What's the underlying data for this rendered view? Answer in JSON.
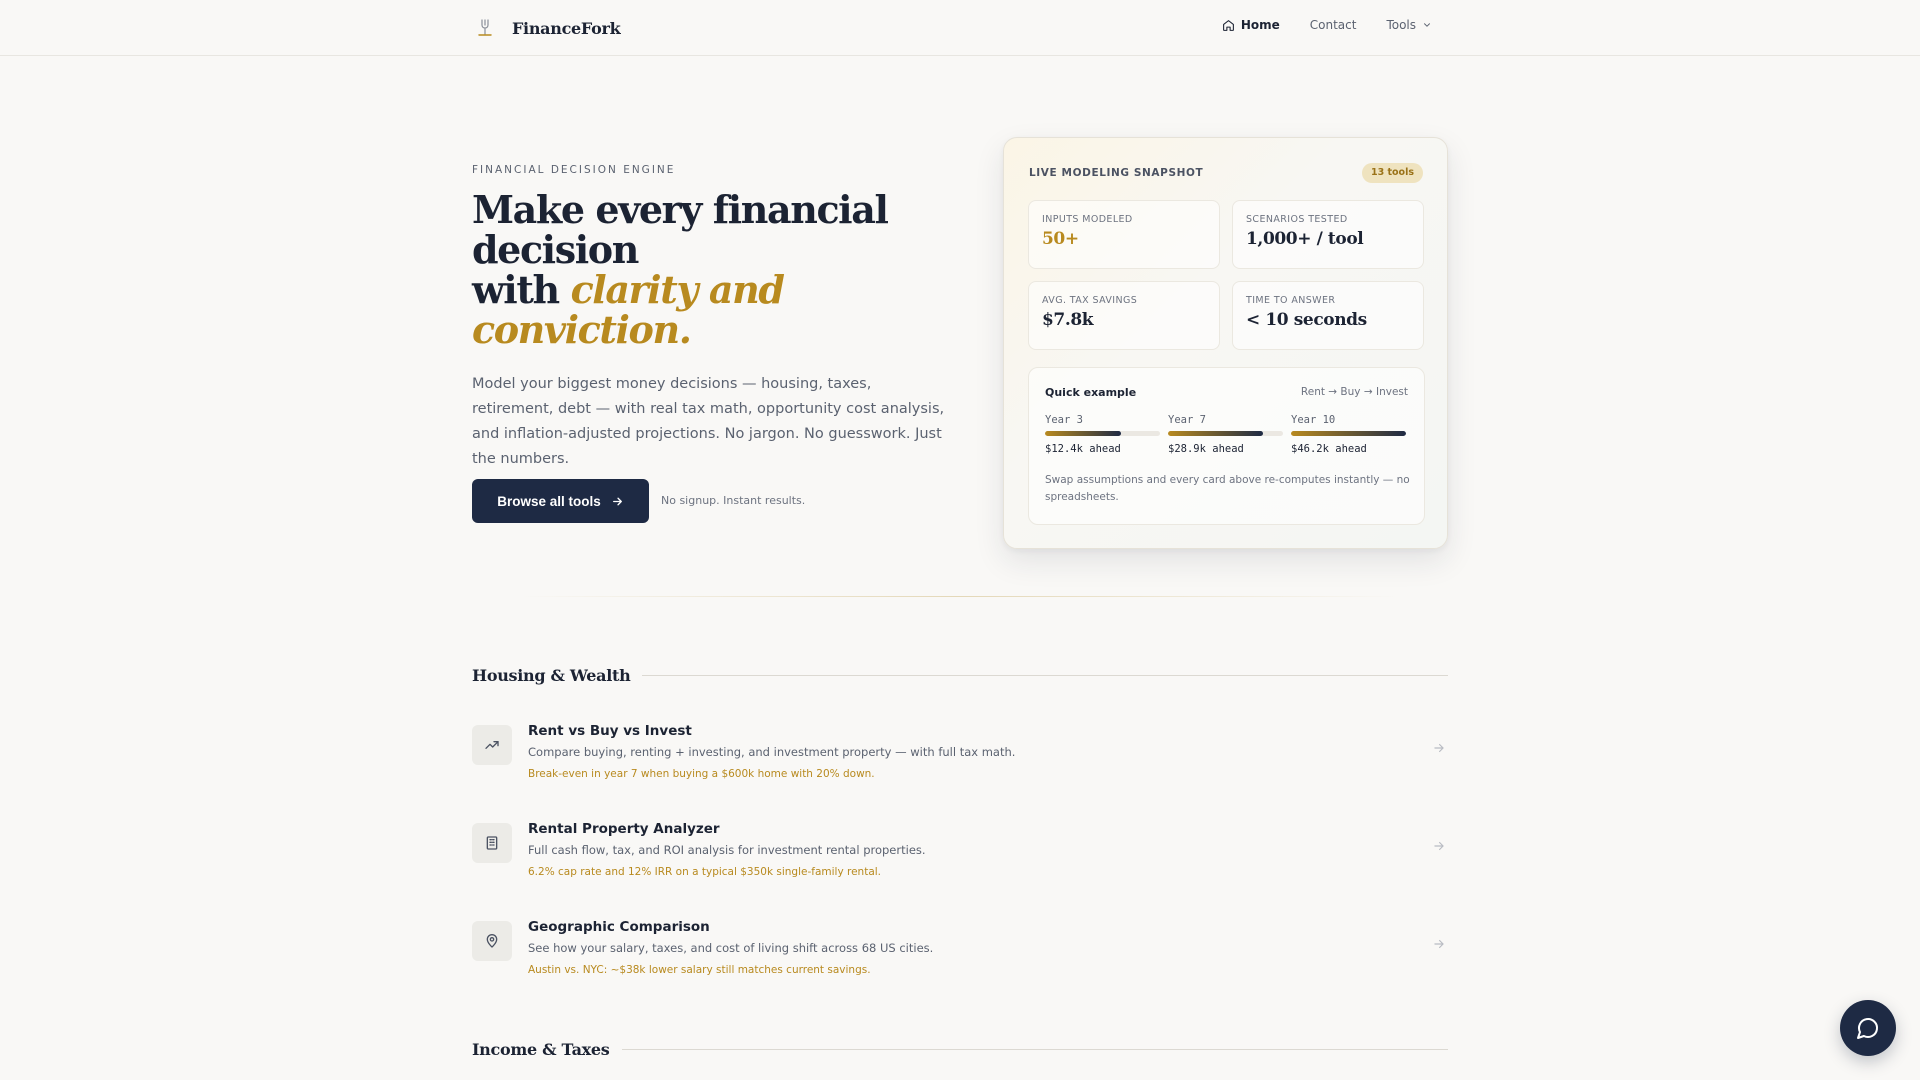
{
  "nav": {
    "brand": "FinanceFork",
    "links": [
      {
        "label": "Home",
        "active": true
      },
      {
        "label": "Contact",
        "active": false
      },
      {
        "label": "Tools",
        "active": false
      }
    ]
  },
  "hero": {
    "eyebrow": "FINANCIAL DECISION ENGINE",
    "title_line1": "Make every financial",
    "title_line2": "decision",
    "title_line3": "with ",
    "title_accent": "clarity and conviction.",
    "description": "Model your biggest money decisions — housing, taxes, retirement, debt — with real tax math, opportunity cost analysis, and inflation-adjusted projections. No jargon. No guesswork. Just the numbers.",
    "cta_label": "Browse all tools",
    "cta_note": "No signup. Instant results."
  },
  "snapshot": {
    "heading": "LIVE MODELING SNAPSHOT",
    "badge": "13 tools",
    "stats": [
      {
        "label": "INPUTS MODELED",
        "value": "50+"
      },
      {
        "label": "SCENARIOS TESTED",
        "value": "1,000+ / tool"
      },
      {
        "label": "AVG. TAX SAVINGS",
        "value": "$7.8k"
      },
      {
        "label": "TIME TO ANSWER",
        "value": "< 10 seconds"
      }
    ],
    "example": {
      "title": "Quick example",
      "flow": "Rent → Buy → Invest",
      "years": [
        {
          "label": "Year 3",
          "value": "$12.4k ahead",
          "progress": 0.66
        },
        {
          "label": "Year 7",
          "value": "$28.9k ahead",
          "progress": 0.83
        },
        {
          "label": "Year 10",
          "value": "$46.2k ahead",
          "progress": 1.0
        }
      ],
      "note": "Swap assumptions and every card above re-computes instantly — no spreadsheets."
    }
  },
  "sections": [
    {
      "title": "Housing & Wealth",
      "tools": [
        {
          "name": "Rent vs Buy vs Invest",
          "desc": "Compare buying, renting + investing, and investment property — with full tax math.",
          "example": "Break-even in year 7 when buying a $600k home with 20% down.",
          "icon": "trending-up-icon"
        },
        {
          "name": "Rental Property Analyzer",
          "desc": "Full cash flow, tax, and ROI analysis for investment rental properties.",
          "example": "6.2% cap rate and 12% IRR on a typical $350k single-family rental.",
          "icon": "building-icon"
        },
        {
          "name": "Geographic Comparison",
          "desc": "See how your salary, taxes, and cost of living shift across 68 US cities.",
          "example": "Austin vs. NYC: ~$38k lower salary still matches current savings.",
          "icon": "map-pin-icon"
        }
      ]
    },
    {
      "title": "Income & Taxes",
      "tools": []
    }
  ],
  "colors": {
    "accent": "#b88a1f",
    "navy": "#1e2a44",
    "background": "#f9f8f6"
  }
}
